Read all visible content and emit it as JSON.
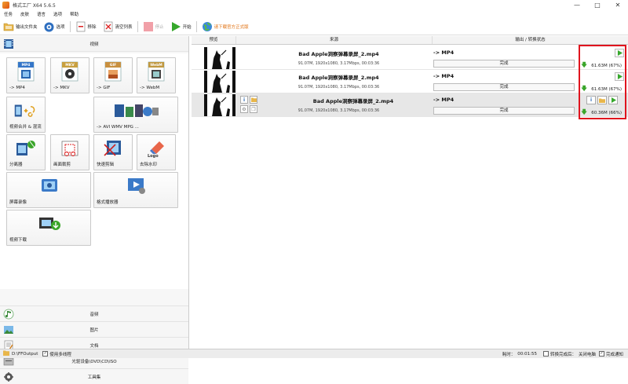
{
  "window": {
    "title": "格式工厂 X64 5.6.5"
  },
  "menu": [
    "任务",
    "皮肤",
    "语言",
    "选项",
    "帮助"
  ],
  "toolbar": {
    "output_folder": "输出文件夹",
    "options": "选项",
    "remove": "移除",
    "clear_list": "清空列表",
    "stop": "停止",
    "start": "开始",
    "download": "请下载官方正式版"
  },
  "left": {
    "video_header": "视频",
    "tiles": [
      {
        "label": "-> MP4",
        "badge": "MP4"
      },
      {
        "label": "-> MKV",
        "badge": "MKV"
      },
      {
        "label": "-> GIF",
        "badge": "GIF"
      },
      {
        "label": "-> WebM",
        "badge": "WebM"
      },
      {
        "label": "视频合并 & 混流"
      },
      {
        "label": "-> AVI WMV MPG ..."
      },
      {
        "label": "分离器"
      },
      {
        "label": "画面裁剪"
      },
      {
        "label": "快速剪辑"
      },
      {
        "label": "去除水印"
      },
      {
        "label": "屏幕录像"
      },
      {
        "label": "格式播放器"
      },
      {
        "label": "视频下载"
      }
    ],
    "logo_text": "Logo",
    "categories": [
      "音频",
      "图片",
      "文档",
      "光驱设备\\DVD\\CD\\ISO",
      "工具集"
    ]
  },
  "table": {
    "headers": {
      "preview": "预览",
      "source": "来源",
      "output": "输出 / 转换状态"
    },
    "rows": [
      {
        "name": "Bad Apple洞察弹幕录屏_2.mp4",
        "info": "91.07M, 1920x1080, 3.17Mbps, 00:03:36",
        "target": "-> MP4",
        "status": "完成",
        "size": "61.63M",
        "pct": "(67%)"
      },
      {
        "name": "Bad Apple洞察弹幕录屏_2.mp4",
        "info": "91.07M, 1920x1080, 3.17Mbps, 00:03:36",
        "target": "-> MP4",
        "status": "完成",
        "size": "61.63M",
        "pct": "(67%)"
      },
      {
        "name": "Bad Apple洞察弹幕录屏_2.mp4",
        "info": "91.07M, 1920x1080, 3.17Mbps, 00:03:36",
        "target": "-> MP4",
        "status": "完成",
        "size": "60.36M",
        "pct": "(66%)"
      }
    ]
  },
  "statusbar": {
    "path": "D:\\FFOutput",
    "multithread": "使用多线程",
    "elapsed_label": "耗时：",
    "elapsed": "00:01:55",
    "after_label": "转换完成后：",
    "shutdown": "关闭电脑",
    "notify": "完成通知"
  }
}
